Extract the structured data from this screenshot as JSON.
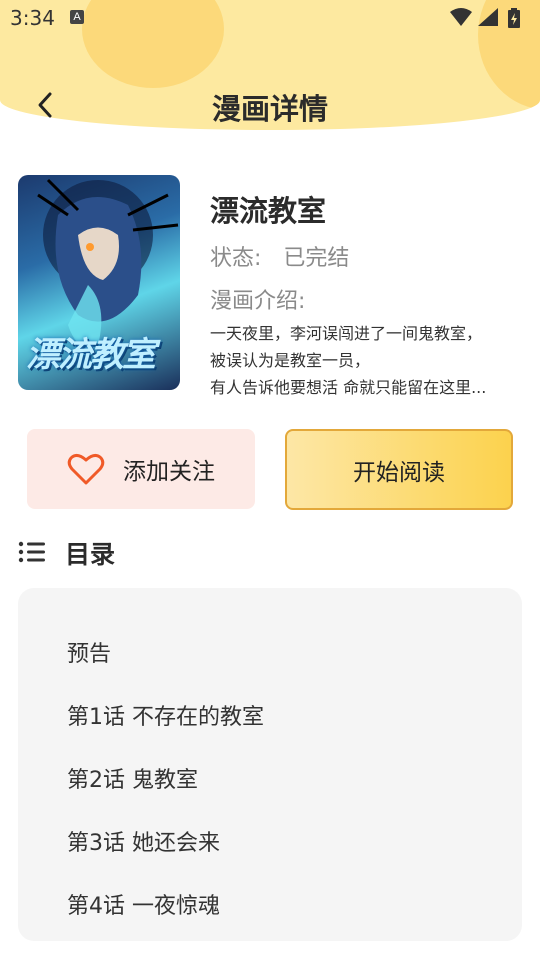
{
  "status_bar": {
    "time": "3:34",
    "notification_badge": "A"
  },
  "header": {
    "title": "漫画详情",
    "back_icon": "chevron-left-icon"
  },
  "comic": {
    "cover_title": "漂流教室",
    "name": "漂流教室",
    "status_label": "状态:",
    "status_value": "已完结",
    "intro_label": "漫画介绍:",
    "intro_lines": [
      "一天夜里，李河误闯进了一间鬼教室，",
      "被误认为是教室一员，",
      "有人告诉他要想活 命就只能留在这里..."
    ]
  },
  "actions": {
    "follow_label": "添加关注",
    "follow_icon": "heart-icon",
    "read_label": "开始阅读"
  },
  "catalog": {
    "icon": "list-icon",
    "title": "目录",
    "chapters": [
      "预告",
      "第1话 不存在的教室",
      "第2话 鬼教室",
      "第3话 她还会来",
      "第4话 一夜惊魂"
    ]
  },
  "colors": {
    "header_bg": "#fde9a0",
    "accent_yellow": "#fcd24d",
    "follow_bg": "#fdeae6",
    "heart": "#f05a28"
  }
}
